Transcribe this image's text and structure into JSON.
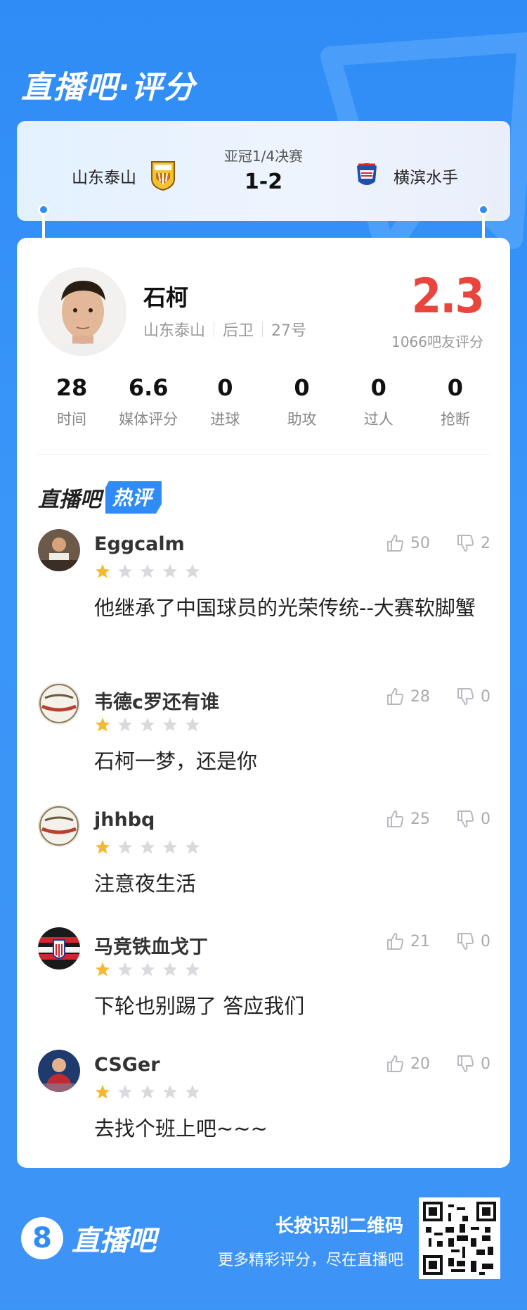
{
  "header": {
    "title": "直播吧·评分"
  },
  "match": {
    "home_team": "山东泰山",
    "away_team": "横滨水手",
    "stage": "亚冠1/4决赛",
    "score": "1-2"
  },
  "player": {
    "name": "石柯",
    "team": "山东泰山",
    "position": "后卫",
    "number": "27号",
    "rating": "2.3",
    "rating_count": "1066吧友评分"
  },
  "stats": [
    {
      "value": "28",
      "label": "时间"
    },
    {
      "value": "6.6",
      "label": "媒体评分"
    },
    {
      "value": "0",
      "label": "进球"
    },
    {
      "value": "0",
      "label": "助攻"
    },
    {
      "value": "0",
      "label": "过人"
    },
    {
      "value": "0",
      "label": "抢断"
    }
  ],
  "hot_comments": {
    "title_part1": "直播吧",
    "title_part2": "热评",
    "items": [
      {
        "user": "Eggcalm",
        "stars": 1,
        "likes": "50",
        "dislikes": "2",
        "text": "他继承了中国球员的光荣传统--大赛软脚蟹"
      },
      {
        "user": "韦德c罗还有谁",
        "stars": 1,
        "likes": "28",
        "dislikes": "0",
        "text": "石柯一梦，还是你"
      },
      {
        "user": "jhhbq",
        "stars": 1,
        "likes": "25",
        "dislikes": "0",
        "text": "注意夜生活"
      },
      {
        "user": "马竞铁血戈丁",
        "stars": 1,
        "likes": "21",
        "dislikes": "0",
        "text": "下轮也别踢了 答应我们"
      },
      {
        "user": "CSGer",
        "stars": 1,
        "likes": "20",
        "dislikes": "0",
        "text": "去找个班上吧~~~"
      }
    ]
  },
  "footer": {
    "logo_glyph": "8",
    "logo_text": "直播吧",
    "cta_line1": "长按识别二维码",
    "cta_line2": "更多精彩评分，尽在直播吧"
  },
  "colors": {
    "brand_blue": "#2f8cf6",
    "rating_red": "#e8453c",
    "star_gold": "#f5b82e",
    "star_grey": "#d9d9de"
  }
}
